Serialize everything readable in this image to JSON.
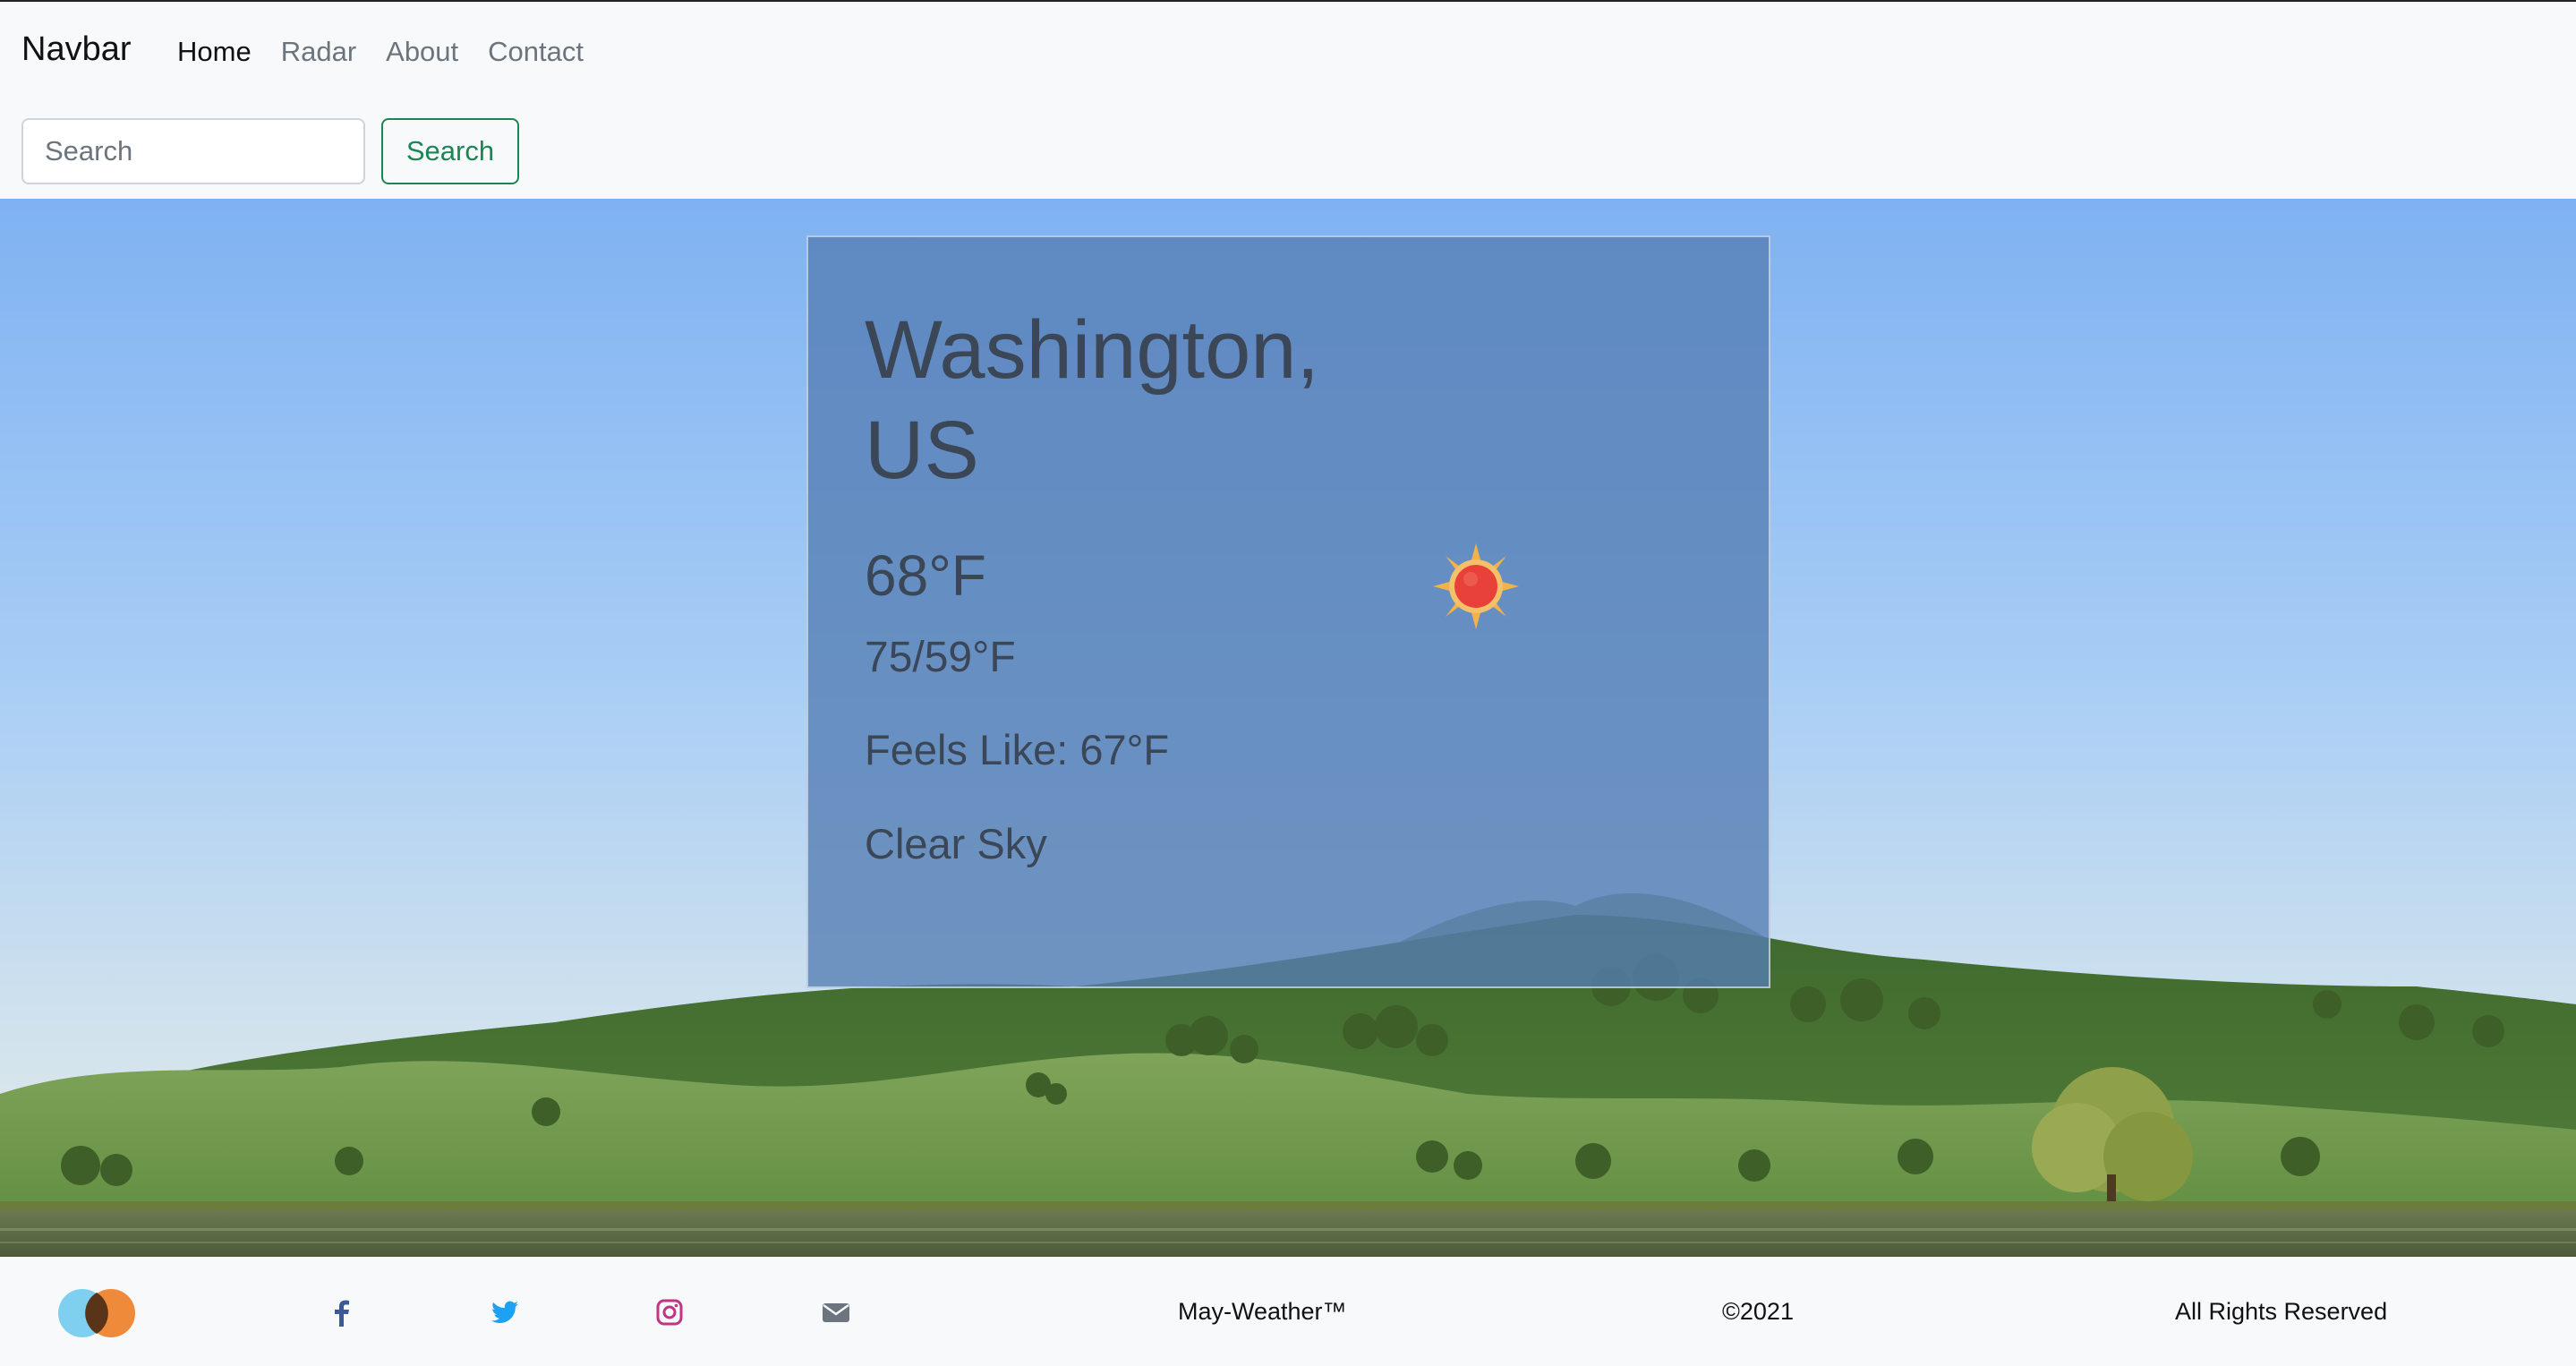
{
  "navbar": {
    "brand": "Navbar",
    "links": [
      "Home",
      "Radar",
      "About",
      "Contact"
    ],
    "active": "Home",
    "search_placeholder": "Search",
    "search_button": "Search"
  },
  "weather": {
    "city": "Washington, US",
    "temperature": "68°F",
    "high_low": "75/59°F",
    "feels_like": "Feels Like: 67°F",
    "description": "Clear Sky",
    "icon": "sun-icon"
  },
  "footer": {
    "logo": "overlapping-circles-logo",
    "social": [
      "facebook-icon",
      "twitter-icon",
      "instagram-icon",
      "envelope-icon"
    ],
    "brand": "May-Weather™",
    "copyright": "©2021",
    "rights": "All Rights Reserved"
  },
  "colors": {
    "success": "#198754",
    "facebook": "#3b5998",
    "twitter": "#1da1f2",
    "instagram": "#c13584",
    "email": "#6c757d"
  }
}
